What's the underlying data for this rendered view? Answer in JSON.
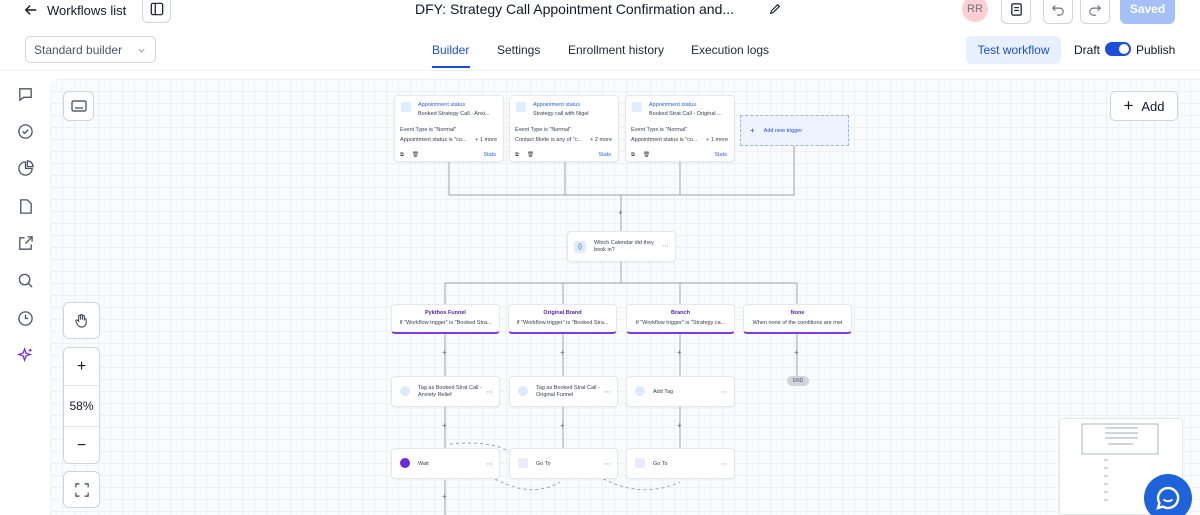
{
  "header": {
    "back_label": "Workflows list",
    "title": "DFY: Strategy Call Appointment Confirmation and...",
    "avatar_initials": "RR",
    "saved_label": "Saved"
  },
  "subheader": {
    "builder_mode": "Standard builder",
    "tabs": [
      {
        "label": "Builder",
        "active": true
      },
      {
        "label": "Settings",
        "active": false
      },
      {
        "label": "Enrollment history",
        "active": false
      },
      {
        "label": "Execution logs",
        "active": false
      }
    ],
    "test_workflow_label": "Test workflow",
    "draft_label": "Draft",
    "publish_label": "Publish",
    "publish_toggle_on": true
  },
  "canvas": {
    "add_label": "Add",
    "zoom_level": "58%",
    "zoom_in": "+",
    "zoom_out": "−",
    "triggers": [
      {
        "title": "Appointment status",
        "subtitle": "Booked Strategy Call - Anxi...",
        "line1": "Event Type is \"Normal\"",
        "line2": "Appointment status is \"co...",
        "more": "+ 1 more",
        "stats": "Stats"
      },
      {
        "title": "Appointment status",
        "subtitle": "Strategy call with Nigel",
        "line1": "Event Type is \"Normal\"",
        "line2": "Contact Mode is any of \"c...",
        "more": "+ 2 more",
        "stats": "Stats"
      },
      {
        "title": "Appointment status",
        "subtitle": "Booked Strat Call - Original ...",
        "line1": "Event Type is \"Normal\"",
        "line2": "Appointment status is \"co...",
        "more": "+ 1 more",
        "stats": "Stats"
      }
    ],
    "add_new_trigger": "Add new trigger",
    "condition_node": "Which Calendar did they book in?",
    "branches": [
      {
        "title": "Pykthos Funnel",
        "subtitle": "If \"Workflow trigger\" is \"Booked Stra..."
      },
      {
        "title": "Original Brand",
        "subtitle": "If \"Workflow trigger\" is \"Booked Stra..."
      },
      {
        "title": "Branch",
        "subtitle": "If \"Workflow trigger\" is \"Strategy ca..."
      },
      {
        "title": "None",
        "subtitle": "When none of the conditions are met"
      }
    ],
    "actions_row1": [
      {
        "label": "Tag as Booked Strat Call - Anxiety Relief"
      },
      {
        "label": "Tag as Booked Strat Call - Original Funnel"
      },
      {
        "label": "Add Tag"
      }
    ],
    "actions_row2": [
      {
        "label": "Wait"
      },
      {
        "label": "Go To"
      },
      {
        "label": "Go To"
      }
    ],
    "end_label": "END"
  },
  "colors": {
    "accent": "#1d4ed8",
    "branch_accent": "#7c3aed",
    "saved_button": "#a5c0f7",
    "chat_bubble": "#1e63d9"
  }
}
